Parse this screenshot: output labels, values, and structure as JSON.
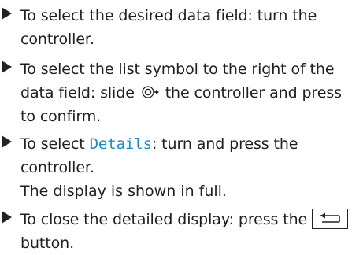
{
  "steps": [
    {
      "text_a": "To select the desired data field: turn the controller."
    },
    {
      "text_a": "To select the list symbol to the right of the data field: slide",
      "slide_symbol": "controller-slide-right-icon",
      "text_b": "the controller and press to confirm."
    },
    {
      "text_a": "To select",
      "ui_word": "Details",
      "text_b": ": turn and press the controller.",
      "result": "The display is shown in full."
    },
    {
      "text_a": "To close the detailed display: press the",
      "button_icon": "back-arrow-icon",
      "text_b": "button."
    }
  ],
  "colors": {
    "text": "#1f1f1f",
    "ui_word": "#1e8bc3",
    "bullet": "#222222"
  }
}
